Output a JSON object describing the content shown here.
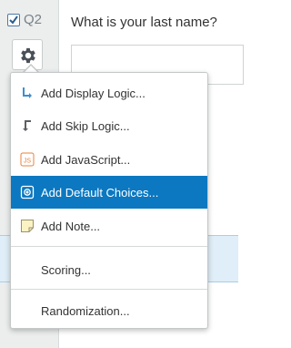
{
  "question": {
    "number": "Q2",
    "text": "What is your last name?",
    "answer_value": ""
  },
  "menu": {
    "items": [
      {
        "label": "Add Display Logic...",
        "icon": "display-logic-arrow-icon"
      },
      {
        "label": "Add Skip Logic...",
        "icon": "skip-logic-arrow-icon"
      },
      {
        "label": "Add JavaScript...",
        "icon": "javascript-icon",
        "icon_text": "JS"
      },
      {
        "label": "Add Default Choices...",
        "icon": "default-choices-icon",
        "active": true
      },
      {
        "label": "Add Note...",
        "icon": "note-icon"
      },
      {
        "label": "Scoring..."
      },
      {
        "label": "Randomization..."
      }
    ]
  },
  "colors": {
    "accent": "#0b78c1",
    "gutter": "#eceeee",
    "selected_band": "#dfeef8"
  }
}
